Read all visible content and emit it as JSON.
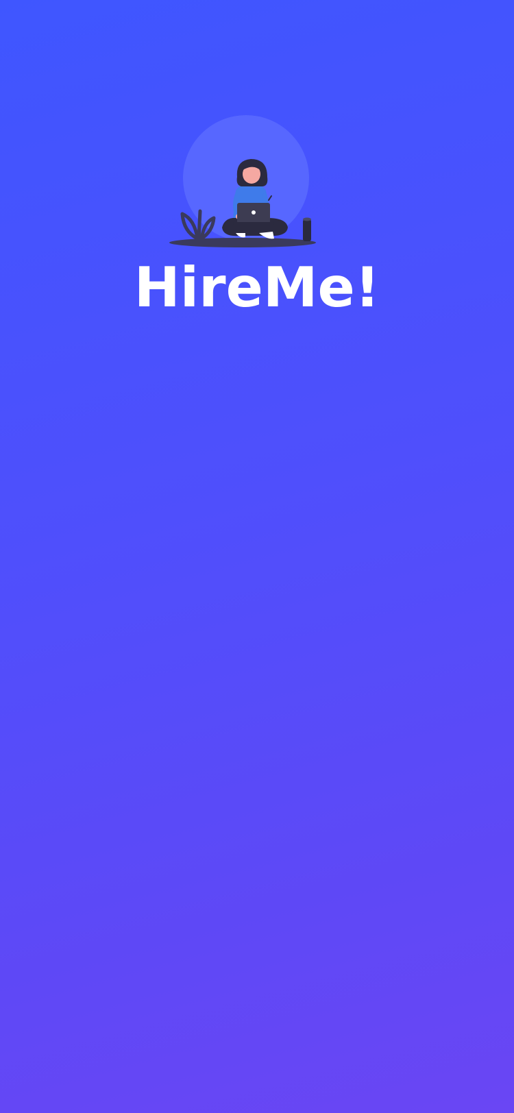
{
  "app": {
    "title": "HireMe!"
  },
  "colors": {
    "gradient_top": "#3f56ff",
    "gradient_bottom": "#6a46f4",
    "title_color": "#ffffff",
    "halo_color": "#5a6bff",
    "ground_color": "#3a3a5c",
    "shirt_color": "#3f7bea",
    "hair_color": "#2b2a3f",
    "skin_color": "#f5a8a2",
    "laptop_color": "#3d3c52"
  },
  "illustration": {
    "icon": "woman-with-laptop-illustration"
  }
}
